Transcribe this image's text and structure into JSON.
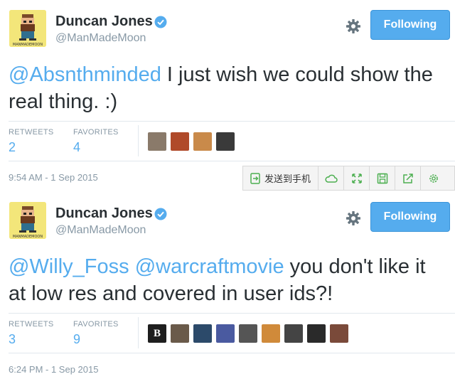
{
  "tweets": [
    {
      "author_name": "Duncan Jones",
      "handle": "@ManMadeMoon",
      "avatar_caption": "MANMADEMOON",
      "follow_label": "Following",
      "text_mentions": [
        "@Absnthminded"
      ],
      "text_body": " I just wish we could show the real thing. :)",
      "retweets_label": "RETWEETS",
      "retweets_count": "2",
      "favorites_label": "FAVORITES",
      "favorites_count": "4",
      "timestamp": "9:54 AM - 1 Sep 2015"
    },
    {
      "author_name": "Duncan Jones",
      "handle": "@ManMadeMoon",
      "avatar_caption": "MANMADEMOON",
      "follow_label": "Following",
      "text_mentions": [
        "@Willy_Foss",
        "@warcraftmovie"
      ],
      "text_body": " you don't like it at low res and covered in user ids?!",
      "retweets_label": "RETWEETS",
      "retweets_count": "3",
      "favorites_label": "FAVORITES",
      "favorites_count": "9",
      "timestamp": "6:24 PM - 1 Sep 2015"
    }
  ],
  "browser_toolbar": {
    "send_label": "发送到手机"
  },
  "colors": {
    "accent": "#55acee",
    "muted": "#8899a6",
    "text": "#292f33"
  },
  "favoriter_avatars_1": [
    "avatar",
    "avatar",
    "avatar",
    "avatar"
  ],
  "favoriter_avatars_2": [
    "B",
    "avatar",
    "avatar",
    "avatar",
    "avatar",
    "avatar",
    "avatar",
    "avatar",
    "avatar"
  ]
}
